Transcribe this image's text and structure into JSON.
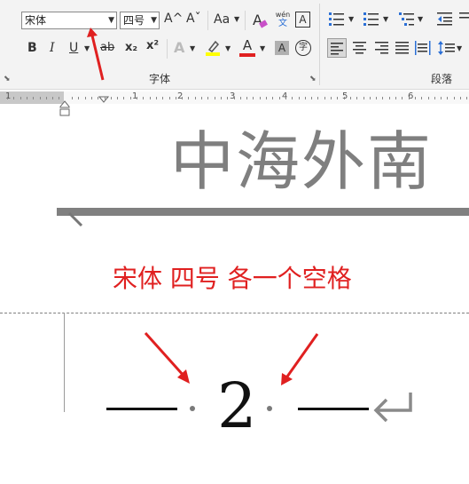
{
  "ribbon": {
    "font_name": "宋体",
    "font_size": "四号",
    "font_group_label": "字体",
    "paragraph_group_label": "段落",
    "grow_font": "A^",
    "shrink_font": "Aˇ",
    "change_case": "Aa",
    "phonetic_top": "wén",
    "phonetic_bottom": "文",
    "char_border": "A",
    "bold": "B",
    "italic": "I",
    "underline": "U",
    "strikethrough": "ab",
    "subscript": "x₂",
    "superscript": "x²",
    "font_color": "A",
    "char_shading": "A",
    "enclose_char": "字"
  },
  "ruler": {
    "numbers": [
      "1",
      "1",
      "2",
      "3",
      "4",
      "5",
      "6"
    ]
  },
  "document": {
    "header_text": "中海外南",
    "annotation": "宋体 四号 各一个空格",
    "page_number": "2"
  },
  "colors": {
    "annotation_red": "#e02020",
    "arrow_red": "#e02020",
    "highlight_yellow": "#ffff00",
    "font_color_red": "#e02020"
  }
}
